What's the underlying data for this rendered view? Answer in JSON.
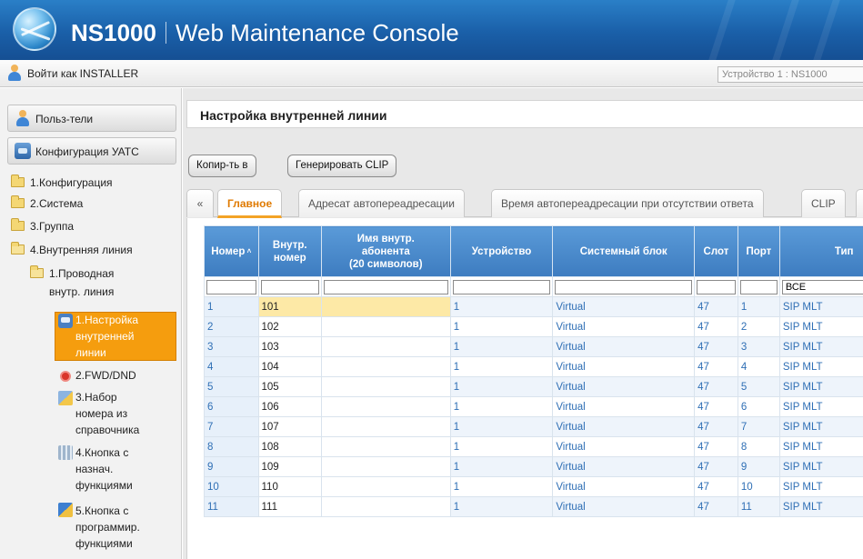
{
  "header": {
    "product": "NS1000",
    "title": "Web Maintenance Console"
  },
  "userbar": {
    "login_label": "Войти как INSTALLER",
    "device": "Устройство 1 : NS1000"
  },
  "sidebar": {
    "users_button": "Польз-тели",
    "config_button": "Конфигурация УАТС",
    "tree": {
      "config": "1.Конфигурация",
      "system": "2.Система",
      "group": "3.Группа",
      "extension": "4.Внутренняя линия",
      "wired_line_1": "1.Проводная",
      "wired_line_2": "внутр. линия",
      "setup_1": "1.Настройка",
      "setup_2": "внутренней",
      "setup_3": "линии",
      "fwd": "2.FWD/DND",
      "dial_1": "3.Набор",
      "dial_2": "номера из",
      "dial_3": "справочника",
      "fbtn_1": "4.Кнопка с",
      "fbtn_2": "назнач.",
      "fbtn_3": "функциями",
      "pbtn_1": "5.Кнопка с",
      "pbtn_2": "программир.",
      "pbtn_3": "функциями"
    }
  },
  "main": {
    "page_title": "Настройка внутренней линии",
    "copy_button": "Копир-ть в",
    "clip_button": "Генерировать CLIP",
    "tabs": {
      "back": "«",
      "main": "Главное",
      "forward_dest": "Адресат автопереадресации",
      "no_answer": "Время автопереадресации при отсутствии ответа",
      "clip": "CLIP"
    }
  },
  "table": {
    "columns": {
      "number": "Номер",
      "ext_1": "Внутр.",
      "ext_2": "номер",
      "name_1": "Имя внутр.",
      "name_2": "абонента",
      "name_3": "(20 символов)",
      "device": "Устройство",
      "unit": "Системный блок",
      "slot": "Слот",
      "port": "Порт",
      "type": "Тип"
    },
    "filter_type": "ВСЕ",
    "rows": [
      {
        "num": "1",
        "ext": "101",
        "name": "",
        "device": "1",
        "unit": "Virtual",
        "slot": "47",
        "port": "1",
        "type": "SIP MLT"
      },
      {
        "num": "2",
        "ext": "102",
        "name": "",
        "device": "1",
        "unit": "Virtual",
        "slot": "47",
        "port": "2",
        "type": "SIP MLT"
      },
      {
        "num": "3",
        "ext": "103",
        "name": "",
        "device": "1",
        "unit": "Virtual",
        "slot": "47",
        "port": "3",
        "type": "SIP MLT"
      },
      {
        "num": "4",
        "ext": "104",
        "name": "",
        "device": "1",
        "unit": "Virtual",
        "slot": "47",
        "port": "4",
        "type": "SIP MLT"
      },
      {
        "num": "5",
        "ext": "105",
        "name": "",
        "device": "1",
        "unit": "Virtual",
        "slot": "47",
        "port": "5",
        "type": "SIP MLT"
      },
      {
        "num": "6",
        "ext": "106",
        "name": "",
        "device": "1",
        "unit": "Virtual",
        "slot": "47",
        "port": "6",
        "type": "SIP MLT"
      },
      {
        "num": "7",
        "ext": "107",
        "name": "",
        "device": "1",
        "unit": "Virtual",
        "slot": "47",
        "port": "7",
        "type": "SIP MLT"
      },
      {
        "num": "8",
        "ext": "108",
        "name": "",
        "device": "1",
        "unit": "Virtual",
        "slot": "47",
        "port": "8",
        "type": "SIP MLT"
      },
      {
        "num": "9",
        "ext": "109",
        "name": "",
        "device": "1",
        "unit": "Virtual",
        "slot": "47",
        "port": "9",
        "type": "SIP MLT"
      },
      {
        "num": "10",
        "ext": "110",
        "name": "",
        "device": "1",
        "unit": "Virtual",
        "slot": "47",
        "port": "10",
        "type": "SIP MLT"
      },
      {
        "num": "11",
        "ext": "111",
        "name": "",
        "device": "1",
        "unit": "Virtual",
        "slot": "47",
        "port": "11",
        "type": "SIP MLT"
      }
    ]
  }
}
